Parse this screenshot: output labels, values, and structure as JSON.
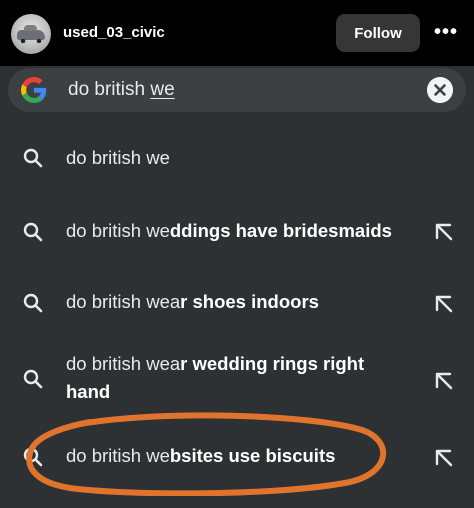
{
  "header": {
    "username": "used_03_civic",
    "follow_label": "Follow",
    "more_label": "•••"
  },
  "search": {
    "query_prefix": "do british ",
    "query_underlined": "we",
    "engine_icon": "google-g-icon",
    "clear_icon": "clear-x-icon"
  },
  "suggestions": [
    {
      "typed": "do british we",
      "completion": "",
      "icon": "search-icon",
      "action_icon": ""
    },
    {
      "typed": "do british we",
      "completion": "ddings have bridesmaids",
      "icon": "search-icon",
      "action_icon": "arrow-up-left-icon"
    },
    {
      "typed": "do british wea",
      "completion": "r shoes indoors",
      "icon": "search-icon",
      "action_icon": "arrow-up-left-icon"
    },
    {
      "typed": "do british wea",
      "completion": "r wedding rings right",
      "completion_line2": "hand",
      "icon": "search-icon",
      "action_icon": "arrow-up-left-icon"
    },
    {
      "typed": "do british we",
      "completion": "bsites use biscuits",
      "icon": "search-icon",
      "action_icon": "arrow-up-left-icon"
    }
  ],
  "colors": {
    "panel_bg": "#2e3134",
    "search_bar_bg": "#3c4043",
    "annotation_circle": "#e0742c"
  }
}
